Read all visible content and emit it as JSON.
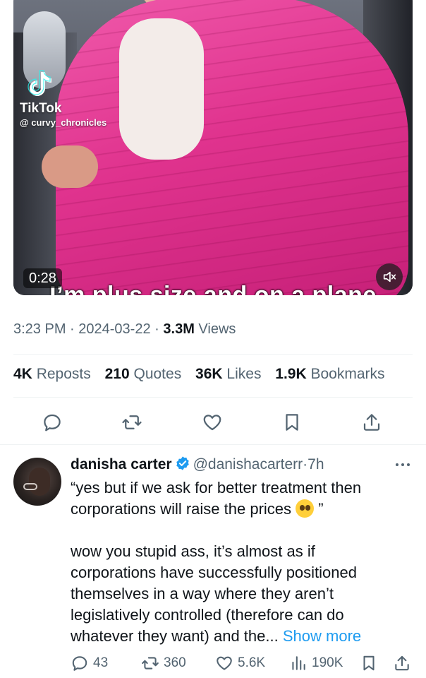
{
  "video": {
    "brand": "TikTok",
    "handle": "@ curvy_chronicles",
    "duration": "0:28",
    "caption": "I’m plus size and on a plane"
  },
  "meta": {
    "time": "3:23 PM",
    "date": "2024-03-22",
    "views": "3.3M",
    "views_label": "Views",
    "sep": "·"
  },
  "stats": {
    "reposts": "4K",
    "reposts_label": "Reposts",
    "quotes": "210",
    "quotes_label": "Quotes",
    "likes": "36K",
    "likes_label": "Likes",
    "bookmarks": "1.9K",
    "bookmarks_label": "Bookmarks"
  },
  "actions": [
    "reply-icon",
    "repost-icon",
    "like-icon",
    "bookmark-icon",
    "share-icon"
  ],
  "reply": {
    "name": "danisha carter",
    "handle": "@danishacarterr",
    "time": "7h",
    "sep": "·",
    "line1": "“yes but if we ask for better treatment then corporations will raise the prices",
    "line1_end": "”",
    "line2": "wow you stupid ass, it’s almost as if corporations have successfully positioned themselves in a way where they aren’t legislatively controlled (therefore can do whatever they want) and the...",
    "show_more": "Show more",
    "counts": {
      "replies": "43",
      "reposts": "360",
      "likes": "5.6K",
      "views": "190K"
    }
  },
  "colors": {
    "accent": "#1d9bf0",
    "text": "#0f1419",
    "muted": "#536471",
    "divider": "#eff3f4"
  }
}
